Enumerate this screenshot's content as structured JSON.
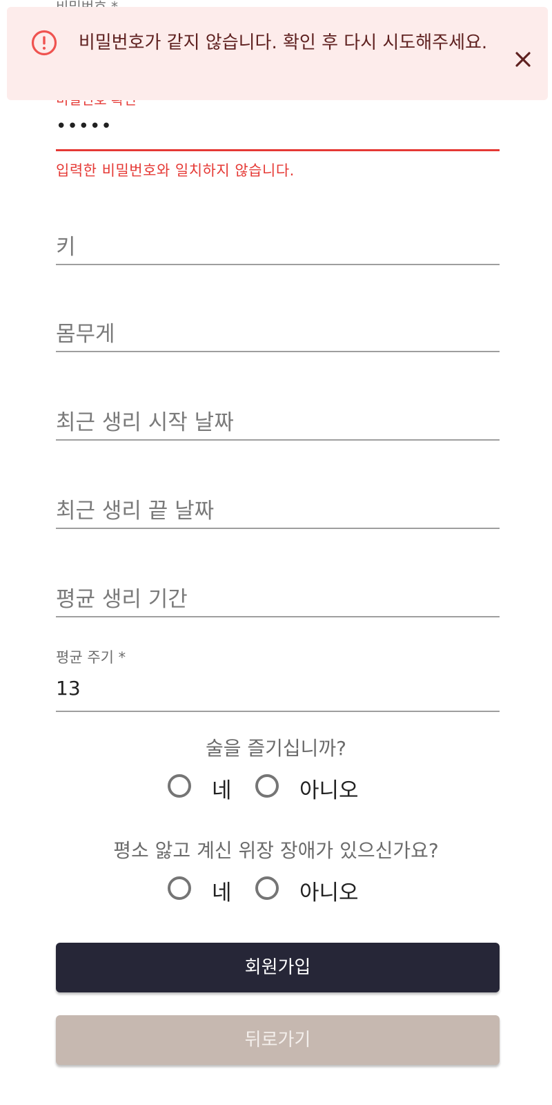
{
  "form": {
    "password_label_cut": "비밀번호 *",
    "password_confirm": {
      "label": "비밀번호 확인 *",
      "value": "•••••",
      "error": "입력한 비밀번호와 일치하지 않습니다."
    },
    "fields": {
      "height_placeholder": "키",
      "weight_placeholder": "몸무게",
      "last_period_start_placeholder": "최근 생리 시작 날짜",
      "last_period_end_placeholder": "최근 생리 끝 날짜",
      "avg_period_length_placeholder": "평균 생리 기간",
      "avg_cycle": {
        "label": "평균 주기 *",
        "value": "13"
      }
    },
    "questions": [
      {
        "text": "술을 즐기십니까?",
        "options": [
          "네",
          "아니오"
        ]
      },
      {
        "text": "평소 앓고 계신 위장 장애가 있으신가요?",
        "options": [
          "네",
          "아니오"
        ]
      }
    ],
    "buttons": {
      "signup": "회원가입",
      "back": "뒤로가기"
    }
  },
  "alert": {
    "message": "비밀번호가 같지 않습니다. 확인 후 다시 시도해주세요.",
    "icon": "error-outline-icon",
    "close_icon": "close-icon",
    "severity_color": "#ef5350"
  },
  "colors": {
    "primary_button": "#262637",
    "secondary_button": "#c6b8b0",
    "error": "#e53935",
    "alert_background": "#fdeceb"
  }
}
